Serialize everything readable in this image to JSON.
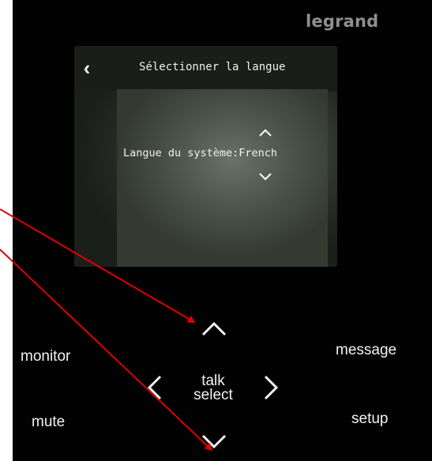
{
  "device": {
    "brand": "legrand"
  },
  "screen": {
    "title": "Sélectionner la langue",
    "back_icon": "chevron-left-icon",
    "setting_label": "Langue du système:French",
    "up_icon": "chevron-up-icon",
    "down_icon": "chevron-down-icon"
  },
  "buttons": {
    "monitor": "monitor",
    "message": "message",
    "mute": "mute",
    "setup": "setup",
    "talk": "talk",
    "select": "select"
  },
  "colors": {
    "device_body": "#020202",
    "text": "#f2f2f2",
    "brand": "#8f8f8f",
    "annotation_arrow": "#e00000"
  }
}
